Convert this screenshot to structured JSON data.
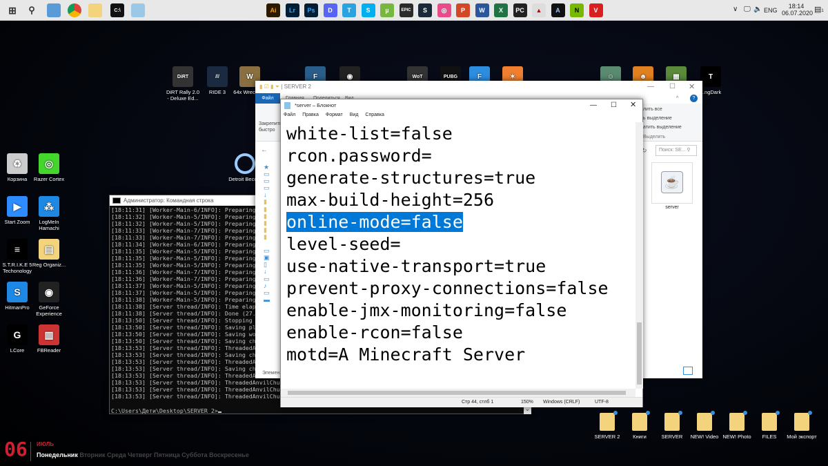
{
  "taskbar": {
    "left_icons": [
      "windows-start-icon",
      "search-icon",
      "explorer-icon",
      "chrome-icon",
      "folder-icon",
      "terminal-icon",
      "app-icon"
    ],
    "apps": [
      {
        "name": "illustrator",
        "label": "Ai",
        "color": "#2b1a00",
        "fg": "#ff9a00"
      },
      {
        "name": "lightroom",
        "label": "Lr",
        "color": "#001e36",
        "fg": "#31a8ff"
      },
      {
        "name": "photoshop",
        "label": "Ps",
        "color": "#001e36",
        "fg": "#31a8ff"
      },
      {
        "name": "discord",
        "label": "D",
        "color": "#5865f2",
        "fg": "#fff"
      },
      {
        "name": "telegram",
        "label": "T",
        "color": "#2aa3df",
        "fg": "#fff"
      },
      {
        "name": "skype",
        "label": "S",
        "color": "#00aff0",
        "fg": "#fff"
      },
      {
        "name": "utorrent",
        "label": "µ",
        "color": "#76b83f",
        "fg": "#fff"
      },
      {
        "name": "epic-games",
        "label": "EPIC",
        "color": "#2a2a2a",
        "fg": "#fff"
      },
      {
        "name": "steam",
        "label": "S",
        "color": "#1b2838",
        "fg": "#fff"
      },
      {
        "name": "app",
        "label": "◎",
        "color": "#e84a8a",
        "fg": "#fff"
      },
      {
        "name": "powerpoint",
        "label": "P",
        "color": "#d24726",
        "fg": "#fff"
      },
      {
        "name": "word",
        "label": "W",
        "color": "#2b579a",
        "fg": "#fff"
      },
      {
        "name": "excel",
        "label": "X",
        "color": "#217346",
        "fg": "#fff"
      },
      {
        "name": "pc",
        "label": "PC",
        "color": "#222",
        "fg": "#fff"
      },
      {
        "name": "app-2",
        "label": "▲",
        "color": "#ddd",
        "fg": "#c00"
      },
      {
        "name": "aura",
        "label": "A",
        "color": "#111",
        "fg": "#9cf"
      },
      {
        "name": "nvidia",
        "label": "N",
        "color": "#76b900",
        "fg": "#000"
      },
      {
        "name": "vivaldi",
        "label": "V",
        "color": "#d82020",
        "fg": "#fff"
      }
    ],
    "tray": {
      "lang": "ENG",
      "time": "18:14",
      "date": "06.07.2020",
      "notifications": "1"
    }
  },
  "desktop": {
    "top_icons": [
      {
        "label": "DiRT Rally 2.0 - Deluxe Ed...",
        "color": "#333",
        "glyph": "DiRT"
      },
      {
        "label": "RIDE 3",
        "color": "#1a2a40",
        "glyph": "///"
      },
      {
        "label": "64x Wreckfest",
        "color": "#8a7040",
        "glyph": "W"
      },
      {
        "label": "",
        "color": "#2a5e8a",
        "glyph": "F"
      },
      {
        "label": "",
        "color": "#222",
        "glyph": "◉"
      },
      {
        "label": "",
        "color": "#333",
        "glyph": "WoT"
      },
      {
        "label": "",
        "color": "#111",
        "glyph": "PUBG"
      },
      {
        "label": "",
        "color": "#2d8ee0",
        "glyph": "F"
      },
      {
        "label": "",
        "color": "#f08030",
        "glyph": "✶"
      },
      {
        "label": "",
        "color": "#5a8a70",
        "glyph": "☺"
      },
      {
        "label": "",
        "color": "#e08020",
        "glyph": "☻"
      },
      {
        "label": "",
        "color": "#5a8a3a",
        "glyph": "▦"
      },
      {
        "label": "...ngDark",
        "color": "#000",
        "glyph": "T"
      }
    ],
    "left_icons": [
      {
        "label": "Корзина",
        "color": "#ccc",
        "glyph": "♻"
      },
      {
        "label": "Razer Cortex",
        "color": "#44d62c",
        "glyph": "◎"
      },
      {
        "label": "Start Zoom",
        "color": "#2d8cff",
        "glyph": "▶"
      },
      {
        "label": "LogMeIn Hamachi",
        "color": "#1e88e5",
        "glyph": "⁂"
      },
      {
        "label": "S.T.R.I.K.E 5 Techonology",
        "color": "#000",
        "glyph": "≡"
      },
      {
        "label": "Reg Organiz...",
        "color": "#f3d37c",
        "glyph": "▤"
      },
      {
        "label": "HitmanPro",
        "color": "#1e88e5",
        "glyph": "S"
      },
      {
        "label": "GeForce Experience",
        "color": "#222",
        "glyph": "◉"
      },
      {
        "label": "LCore",
        "color": "#000",
        "glyph": "G"
      },
      {
        "label": "FBReader",
        "color": "#c33",
        "glyph": "▥"
      }
    ],
    "detroit_icon": {
      "label": "Detroit Beco...",
      "glyph": "○"
    },
    "bottom_folders": [
      "SERVER 2",
      "Книги",
      "SERVER",
      "NEW! Video",
      "NEW! Photo",
      "FILES",
      "Мой экспорт"
    ],
    "calendar": {
      "day": "06",
      "month": "ИЮЛЬ",
      "today": "Понедельник",
      "other_days": "Вторник Среда Четверг Пятница Суббота Воскресенье"
    }
  },
  "cmd": {
    "title": "Администратор: Командная строка",
    "lines": [
      "[18:11:31] [Worker-Main-6/INFO]: Preparing",
      "[18:11:32] [Worker-Main-5/INFO]: Preparing",
      "[18:11:32] [Worker-Main-5/INFO]: Preparing",
      "[18:11:33] [Worker-Main-7/INFO]: Preparing",
      "[18:11:33] [Worker-Main-7/INFO]: Preparing",
      "[18:11:34] [Worker-Main-6/INFO]: Preparing",
      "[18:11:35] [Worker-Main-5/INFO]: Preparing",
      "[18:11:35] [Worker-Main-5/INFO]: Preparing",
      "[18:11:35] [Worker-Main-5/INFO]: Preparing",
      "[18:11:36] [Worker-Main-7/INFO]: Preparing",
      "[18:11:36] [Worker-Main-7/INFO]: Preparing",
      "[18:11:37] [Worker-Main-5/INFO]: Preparing",
      "[18:11:37] [Worker-Main-5/INFO]: Preparing",
      "[18:11:38] [Worker-Main-5/INFO]: Preparing",
      "[18:11:38] [Server thread/INFO]: Time elap",
      "[18:11:38] [Server thread/INFO]: Done (27.",
      "[18:13:50] [Server thread/INFO]: Stopping",
      "[18:13:50] [Server thread/INFO]: Saving pl",
      "[18:13:50] [Server thread/INFO]: Saving wo",
      "[18:13:50] [Server thread/INFO]: Saving ch",
      "[18:13:53] [Server thread/INFO]: ThreadedA",
      "[18:13:53] [Server thread/INFO]: Saving ch",
      "[18:13:53] [Server thread/INFO]: ThreadedA",
      "[18:13:53] [Server thread/INFO]: Saving ch",
      "[18:13:53] [Server thread/INFO]: ThreadedA",
      "[18:13:53] [Server thread/INFO]: ThreadedAnvilChu",
      "[18:13:53] [Server thread/INFO]: ThreadedAnvilChu",
      "[18:13:53] [Server thread/INFO]: ThreadedAnvilChu"
    ],
    "prompt": "C:\\Users\\Дети\\Desktop\\SERVER 2>"
  },
  "explorer": {
    "title": "SERVER 2",
    "tabs": [
      "Файл",
      "Главная",
      "Поделиться",
      "Вид"
    ],
    "ribbon_left": "Закрепить быстро",
    "ribbon_right": [
      "лить все",
      "ь выделение",
      "атить выделение",
      "Выделить"
    ],
    "search_placeholder": "Поиск: SE...",
    "file": "server",
    "status": "Элемен"
  },
  "notepad": {
    "title": "*server – Блокнот",
    "menu": [
      "Файл",
      "Правка",
      "Формат",
      "Вид",
      "Справка"
    ],
    "lines": [
      "white-list=false",
      "rcon.password=",
      "generate-structures=true",
      "max-build-height=256",
      "online-mode=false",
      "level-seed=",
      "use-native-transport=true",
      "prevent-proxy-connections=false",
      "enable-jmx-monitoring=false",
      "enable-rcon=false",
      "motd=A Minecraft Server"
    ],
    "selected_line": "online-mode=false",
    "status": {
      "position": "Стр 44, стлб 1",
      "zoom": "150%",
      "eol": "Windows (CRLF)",
      "encoding": "UTF-8"
    }
  }
}
